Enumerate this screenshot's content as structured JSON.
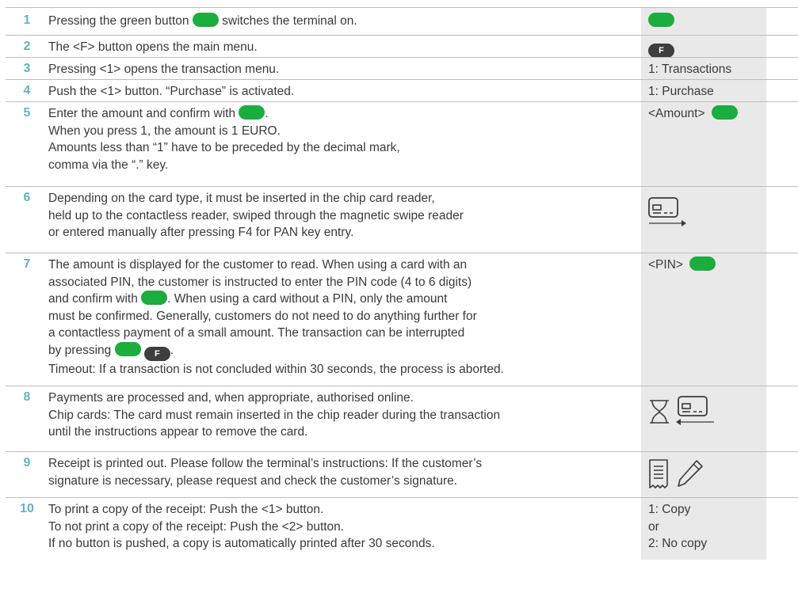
{
  "rows": [
    {
      "num": "1",
      "before": "Pressing the green button",
      "after": "switches the terminal on."
    },
    {
      "num": "2",
      "text": "The <F> button opens the main menu.",
      "key_f": "F"
    },
    {
      "num": "3",
      "text": "Pressing <1> opens the transaction menu.",
      "side": "1: Transactions"
    },
    {
      "num": "4",
      "text": "Push the <1> button. “Purchase” is activated.",
      "side": "1: Purchase"
    },
    {
      "num": "5",
      "line1_before": "Enter the amount and confirm with",
      "line1_after": ".",
      "line2": "When you press 1, the amount is 1 EURO.",
      "line3": "Amounts less than “1” have to be preceded by the decimal mark,",
      "line4": "comma via the “.” key.",
      "side": "<Amount>"
    },
    {
      "num": "6",
      "line1": "Depending on the card type, it must be inserted in the chip card reader,",
      "line2": "held up to the contactless reader, swiped through the magnetic swipe reader",
      "line3": "or entered manually after pressing F4 for PAN key entry.",
      "icon": "card-insert-icon"
    },
    {
      "num": "7",
      "line1": "The amount is displayed for the customer to read. When using a card with an",
      "line2": "associated PIN, the customer is instructed to enter the PIN code (4 to 6 digits)",
      "line3_before": "and confirm with",
      "line3_after": ". When using a card without a PIN, only the amount",
      "line4": "must be confirmed. Generally, customers do not need to do anything further for",
      "line5": "a contactless payment of a small amount. The transaction can be interrupted",
      "line6_before": "by pressing",
      "line6_after": ".",
      "key_f": "F",
      "line7": "Timeout: If a transaction is not concluded within 30 seconds, the process is aborted.",
      "side": "<PIN>"
    },
    {
      "num": "8",
      "line1": "Payments are processed and, when appropriate, authorised online.",
      "line2": "Chip cards: The card must remain inserted in the chip reader during the transaction",
      "line3": "until the instructions appear to remove the card.",
      "icons": [
        "hourglass-icon",
        "card-remove-icon"
      ]
    },
    {
      "num": "9",
      "line1": "Receipt is printed out. Please follow the terminal’s instructions: If the customer’s",
      "line2": "signature is necessary, please request and check the customer’s signature.",
      "icons": [
        "receipt-icon",
        "pencil-icon"
      ]
    },
    {
      "num": "10",
      "line1": "To print a copy of the receipt: Push the <1> button.",
      "line2": "To not print a copy of the receipt: Push the <2> button.",
      "line3": "If no button is pushed, a copy is automatically printed after 30 seconds.",
      "side1": "1: Copy",
      "side2": "or",
      "side3": "2: No copy"
    }
  ],
  "colors": {
    "green_button": "#1bad3e",
    "f_button": "#3e3e3e",
    "number": "#5fb5c2",
    "side_bg": "#e9e9e9"
  }
}
